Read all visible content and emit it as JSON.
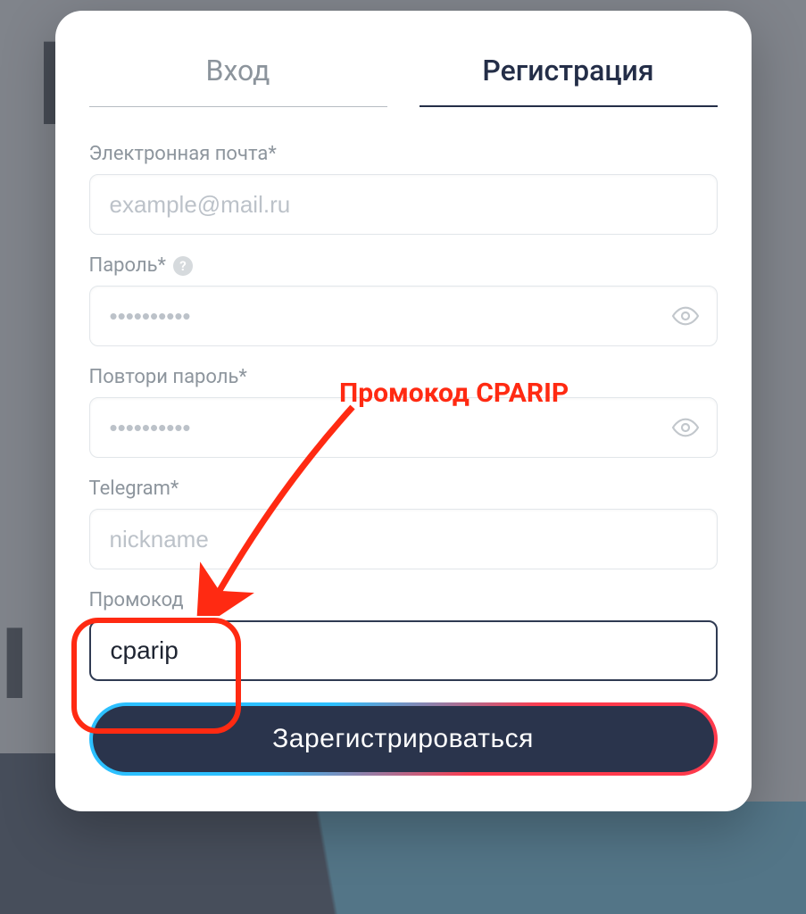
{
  "bg": {
    "top_fragment": "I",
    "mid_fragment": "I"
  },
  "tabs": {
    "login": "Вход",
    "register": "Регистрация"
  },
  "fields": {
    "email": {
      "label": "Электронная почта*",
      "placeholder": "example@mail.ru",
      "value": ""
    },
    "password": {
      "label": "Пароль*",
      "placeholder": "••••••••••",
      "value": ""
    },
    "repeat": {
      "label": "Повтори пароль*",
      "placeholder": "••••••••••",
      "value": ""
    },
    "telegram": {
      "label": "Telegram*",
      "placeholder": "nickname",
      "value": ""
    },
    "promo": {
      "label": "Промокод",
      "placeholder": "",
      "value": "cparip"
    }
  },
  "annotation": {
    "text": "Промокод CPARIP"
  },
  "submit": {
    "label": "Зарегистрироваться"
  },
  "colors": {
    "highlight": "#ff2a12",
    "dark": "#2a344c",
    "tab_active": "#242e48",
    "placeholder": "#bcc2c9"
  }
}
